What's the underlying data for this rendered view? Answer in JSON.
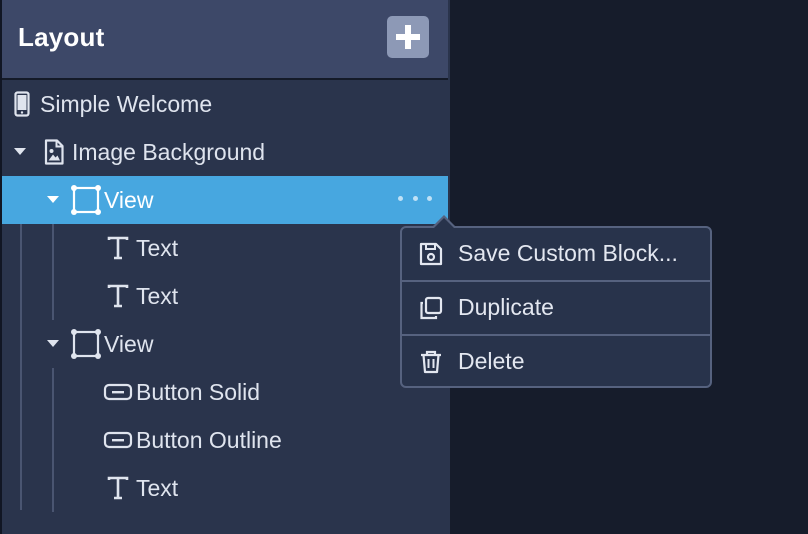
{
  "panel": {
    "title": "Layout",
    "add_icon": "plus-icon"
  },
  "tree": {
    "items": [
      {
        "label": "Simple Welcome",
        "icon": "mobile-device-icon",
        "depth": 0,
        "expanded": null,
        "selected": false
      },
      {
        "label": "Image Background",
        "icon": "image-file-icon",
        "depth": 0,
        "expanded": true,
        "selected": false
      },
      {
        "label": "View",
        "icon": "view-frame-icon",
        "depth": 1,
        "expanded": true,
        "selected": true
      },
      {
        "label": "Text",
        "icon": "text-icon",
        "depth": 2,
        "expanded": null,
        "selected": false
      },
      {
        "label": "Text",
        "icon": "text-icon",
        "depth": 2,
        "expanded": null,
        "selected": false
      },
      {
        "label": "View",
        "icon": "view-frame-icon",
        "depth": 1,
        "expanded": true,
        "selected": false
      },
      {
        "label": "Button Solid",
        "icon": "button-icon",
        "depth": 2,
        "expanded": null,
        "selected": false
      },
      {
        "label": "Button Outline",
        "icon": "button-icon",
        "depth": 2,
        "expanded": null,
        "selected": false
      },
      {
        "label": "Text",
        "icon": "text-icon",
        "depth": 2,
        "expanded": null,
        "selected": false
      }
    ]
  },
  "context_menu": {
    "items": [
      {
        "label": "Save Custom Block...",
        "icon": "save-icon"
      },
      {
        "label": "Duplicate",
        "icon": "duplicate-icon"
      },
      {
        "label": "Delete",
        "icon": "trash-icon"
      }
    ]
  },
  "colors": {
    "selected_row": "#47a7e0",
    "panel_bg": "#2a344c",
    "header_bg": "#3d4868"
  }
}
